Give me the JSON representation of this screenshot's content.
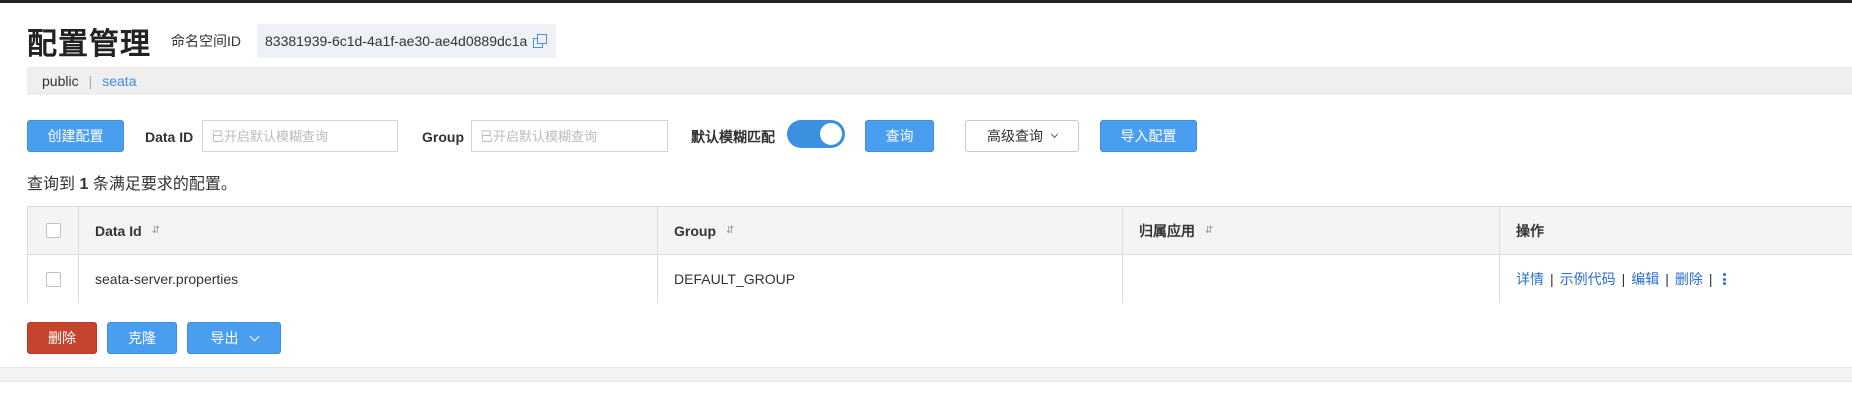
{
  "page": {
    "title": "配置管理",
    "namespace_label": "命名空间ID",
    "namespace_id": "83381939-6c1d-4a1f-ae30-ae4d0889dc1a"
  },
  "namespaces": {
    "public": "public",
    "separator": "|",
    "seata": "seata"
  },
  "toolbar": {
    "create_button": "创建配置",
    "data_id_label": "Data ID",
    "data_id_placeholder": "已开启默认模糊查询",
    "group_label": "Group",
    "group_placeholder": "已开启默认模糊查询",
    "fuzzy_label": "默认模糊匹配",
    "fuzzy_enabled": true,
    "search_button": "查询",
    "advanced_button": "高级查询",
    "import_button": "导入配置"
  },
  "result": {
    "prefix": "查询到",
    "count": "1",
    "suffix": "条满足要求的配置。"
  },
  "table": {
    "headers": {
      "data_id": "Data Id",
      "group": "Group",
      "app": "归属应用",
      "ops": "操作"
    },
    "sort_glyph": "⇵",
    "rows": [
      {
        "data_id": "seata-server.properties",
        "group": "DEFAULT_GROUP",
        "app": ""
      }
    ],
    "actions": {
      "detail": "详情",
      "sample_code": "示例代码",
      "edit": "编辑",
      "delete": "删除",
      "separator": "|"
    }
  },
  "bulk": {
    "delete_button": "删除",
    "clone_button": "克隆",
    "export_button": "导出"
  },
  "colors": {
    "primary": "#4a9ef0",
    "danger": "#c4442e",
    "link": "#2b6fcf"
  }
}
